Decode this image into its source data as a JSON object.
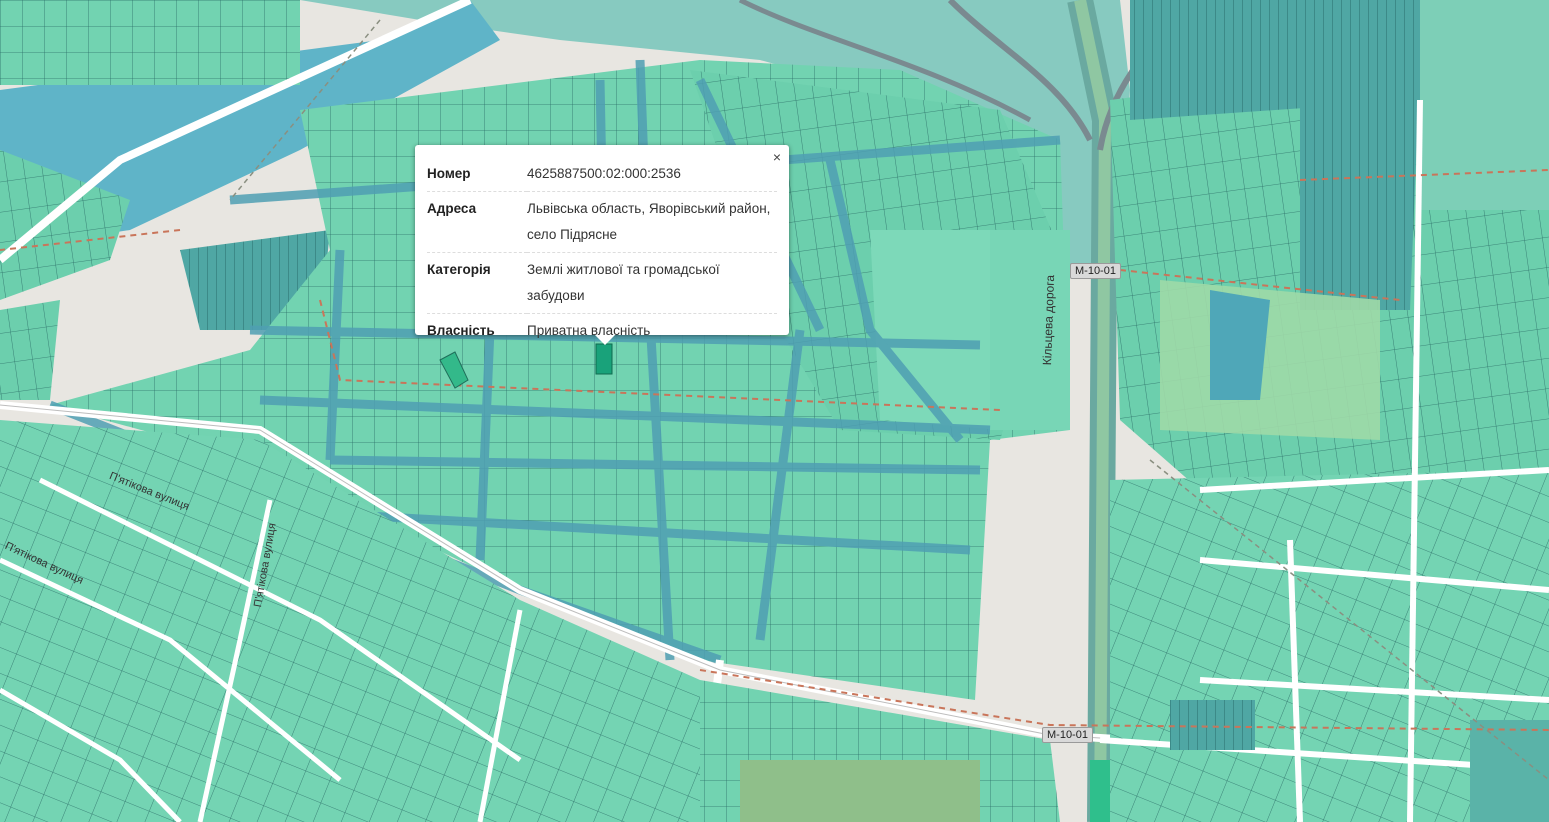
{
  "popup": {
    "close_label": "×",
    "rows": [
      {
        "key": "Номер",
        "value": "4625887500:02:000:2536"
      },
      {
        "key": "Адреса",
        "value": "Львівська область, Яворівський район, село Підрясне"
      },
      {
        "key": "Категорія",
        "value": "Землі житлової та громадської забудови"
      },
      {
        "key": "Власність",
        "value": "Приватна власність"
      }
    ]
  },
  "map": {
    "road_labels": {
      "ring_road": "Кільцева дорога",
      "pyatikova_1": "П'ятікова вулиця",
      "pyatikova_2": "П'ятікова вулиця",
      "pyatikova_3": "П'ятікова вулиця"
    },
    "route_shields": {
      "top": "М-10-01",
      "bottom": "М-10-01"
    },
    "colors": {
      "parcel_fill": "#6fd3b0",
      "parcel_stroke": "#2a6f6a",
      "water_zone": "#5fb7c9",
      "selected_parcel": "#1fa57a",
      "base": "#e8e6e1",
      "road": "#ffffff"
    }
  }
}
